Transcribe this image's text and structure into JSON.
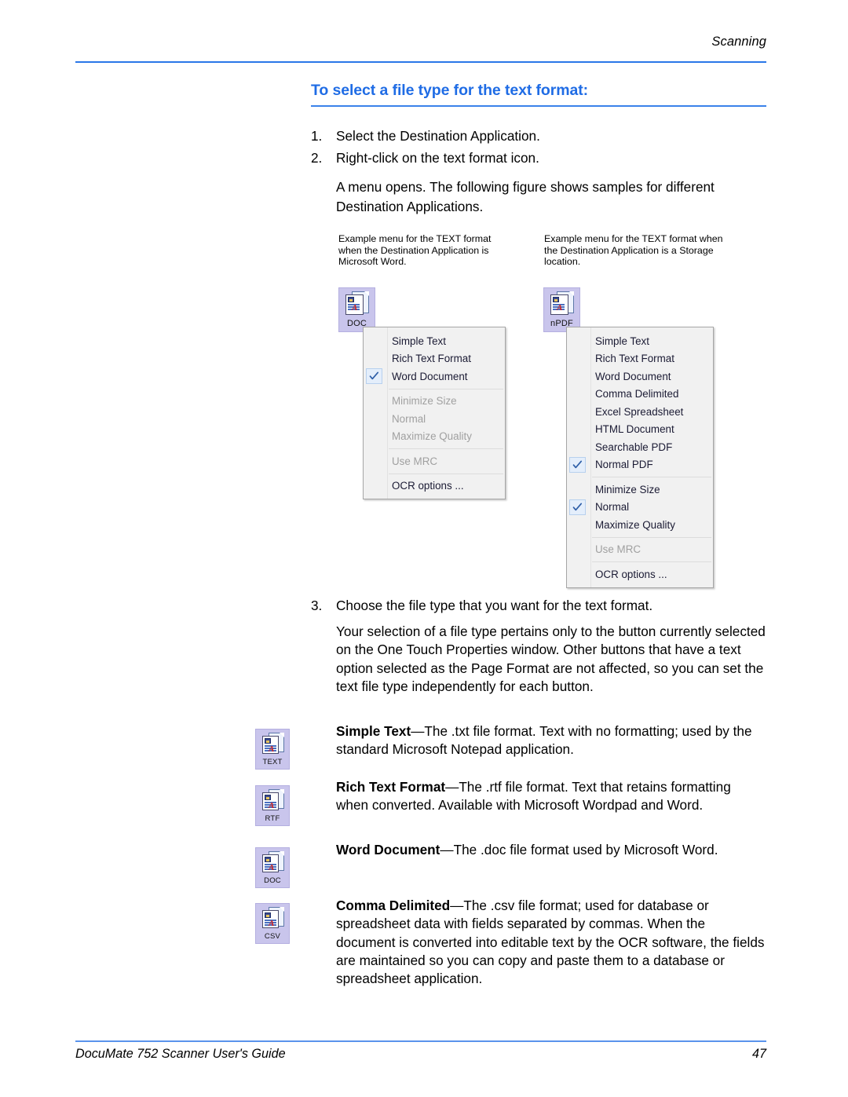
{
  "header": {
    "running_head": "Scanning"
  },
  "section": {
    "title": "To select a file type for the text format:"
  },
  "steps": [
    {
      "num": "1.",
      "text": "Select the Destination Application."
    },
    {
      "num": "2.",
      "text": "Right-click on the text format icon."
    }
  ],
  "step2_note": "A menu opens. The following figure shows samples for different Destination Applications.",
  "step3": {
    "num": "3.",
    "text": "Choose the file type that you want for the text format."
  },
  "step3_note": "Your selection of a file type pertains only to the button currently selected on the One Touch Properties window. Other buttons that have a text option selected as the Page Format are not affected, so you can set the text file type independently for each button.",
  "figure": {
    "caption_left": "Example menu for the TEXT format when the Destination Application is Microsoft Word.",
    "caption_right": "Example menu for the TEXT format when the Destination Application is a Storage location.",
    "icon_left_label": "DOC",
    "icon_right_label": "nPDF",
    "menu_left": {
      "items": [
        {
          "label": "Simple Text",
          "checked": false,
          "disabled": false,
          "sep_after": false
        },
        {
          "label": "Rich Text Format",
          "checked": false,
          "disabled": false,
          "sep_after": false
        },
        {
          "label": "Word Document",
          "checked": true,
          "disabled": false,
          "sep_after": true
        },
        {
          "label": "Minimize Size",
          "checked": false,
          "disabled": true,
          "sep_after": false
        },
        {
          "label": "Normal",
          "checked": false,
          "disabled": true,
          "sep_after": false
        },
        {
          "label": "Maximize Quality",
          "checked": false,
          "disabled": true,
          "sep_after": true
        },
        {
          "label": "Use MRC",
          "checked": false,
          "disabled": true,
          "sep_after": true
        },
        {
          "label": "OCR options ...",
          "checked": false,
          "disabled": false,
          "sep_after": false
        }
      ]
    },
    "menu_right": {
      "items": [
        {
          "label": "Simple Text",
          "checked": false,
          "disabled": false,
          "sep_after": false
        },
        {
          "label": "Rich Text Format",
          "checked": false,
          "disabled": false,
          "sep_after": false
        },
        {
          "label": "Word Document",
          "checked": false,
          "disabled": false,
          "sep_after": false
        },
        {
          "label": "Comma Delimited",
          "checked": false,
          "disabled": false,
          "sep_after": false
        },
        {
          "label": "Excel Spreadsheet",
          "checked": false,
          "disabled": false,
          "sep_after": false
        },
        {
          "label": "HTML Document",
          "checked": false,
          "disabled": false,
          "sep_after": false
        },
        {
          "label": "Searchable PDF",
          "checked": false,
          "disabled": false,
          "sep_after": false
        },
        {
          "label": "Normal PDF",
          "checked": true,
          "disabled": false,
          "sep_after": true
        },
        {
          "label": "Minimize Size",
          "checked": false,
          "disabled": false,
          "sep_after": false
        },
        {
          "label": "Normal",
          "checked": true,
          "disabled": false,
          "sep_after": false
        },
        {
          "label": "Maximize Quality",
          "checked": false,
          "disabled": false,
          "sep_after": true
        },
        {
          "label": "Use MRC",
          "checked": false,
          "disabled": true,
          "sep_after": true
        },
        {
          "label": "OCR options ...",
          "checked": false,
          "disabled": false,
          "sep_after": false
        }
      ]
    }
  },
  "definitions": [
    {
      "icon_label": "TEXT",
      "term": "Simple Text",
      "dash": "—",
      "body": "The .txt file format. Text with no formatting; used by the standard Microsoft Notepad application."
    },
    {
      "icon_label": "RTF",
      "term": "Rich Text Format",
      "dash": "—",
      "body": "The .rtf file format. Text that retains formatting when converted. Available with Microsoft Wordpad and Word."
    },
    {
      "icon_label": "DOC",
      "term": "Word Document",
      "dash": "—",
      "body": "The .doc file format used by Microsoft Word."
    },
    {
      "icon_label": "CSV",
      "term": "Comma Delimited",
      "dash": "—",
      "body": "The .csv file format; used for database or spreadsheet data with fields separated by commas. When the document is converted into editable text by the OCR software, the fields are maintained so you can copy and paste them to a database or spreadsheet application."
    }
  ],
  "footer": {
    "left": "DocuMate 752 Scanner User's Guide",
    "page_number": "47"
  },
  "colors": {
    "accent_rule": "#2a77e8",
    "heading": "#1f6ce5",
    "icon_bg": "#c9c5ec",
    "menu_bg": "#f1f1f1",
    "check_bg": "#e4eefb"
  }
}
